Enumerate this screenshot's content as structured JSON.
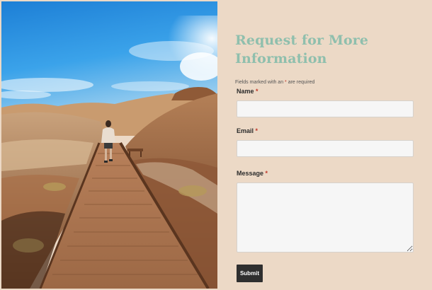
{
  "form": {
    "title": "Request for More Information",
    "required_note_before": "Fields marked with an ",
    "required_star": "*",
    "required_note_after": " are required",
    "fields": [
      {
        "label": "Name",
        "required_marker": "*",
        "value": ""
      },
      {
        "label": "Email",
        "required_marker": "*",
        "value": ""
      },
      {
        "label": "Message",
        "required_marker": "*",
        "value": ""
      }
    ],
    "submit_label": "Submit"
  },
  "colors": {
    "background": "#ecd9c6",
    "title": "#8fbfad",
    "required_star": "#c0392b",
    "button": "#2f2f2f"
  }
}
